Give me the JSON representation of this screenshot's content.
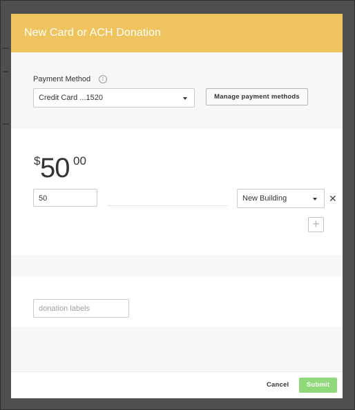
{
  "modal": {
    "title": "New Card or ACH Donation"
  },
  "payment": {
    "label": "Payment Method",
    "info_icon": "info-icon",
    "selected_method": "Credit Card ...1520",
    "manage_button": "Manage payment methods"
  },
  "amount": {
    "currency_symbol": "$",
    "whole": "50",
    "cents": "00",
    "input_value": "50",
    "fund_selected": "New Building"
  },
  "labels": {
    "placeholder": "donation labels"
  },
  "footer": {
    "cancel_label": "Cancel",
    "submit_label": "Submit",
    "submit_color": "#8fd97a"
  },
  "colors": {
    "header": "#efc35d",
    "backdrop": "#4f4f4f"
  }
}
